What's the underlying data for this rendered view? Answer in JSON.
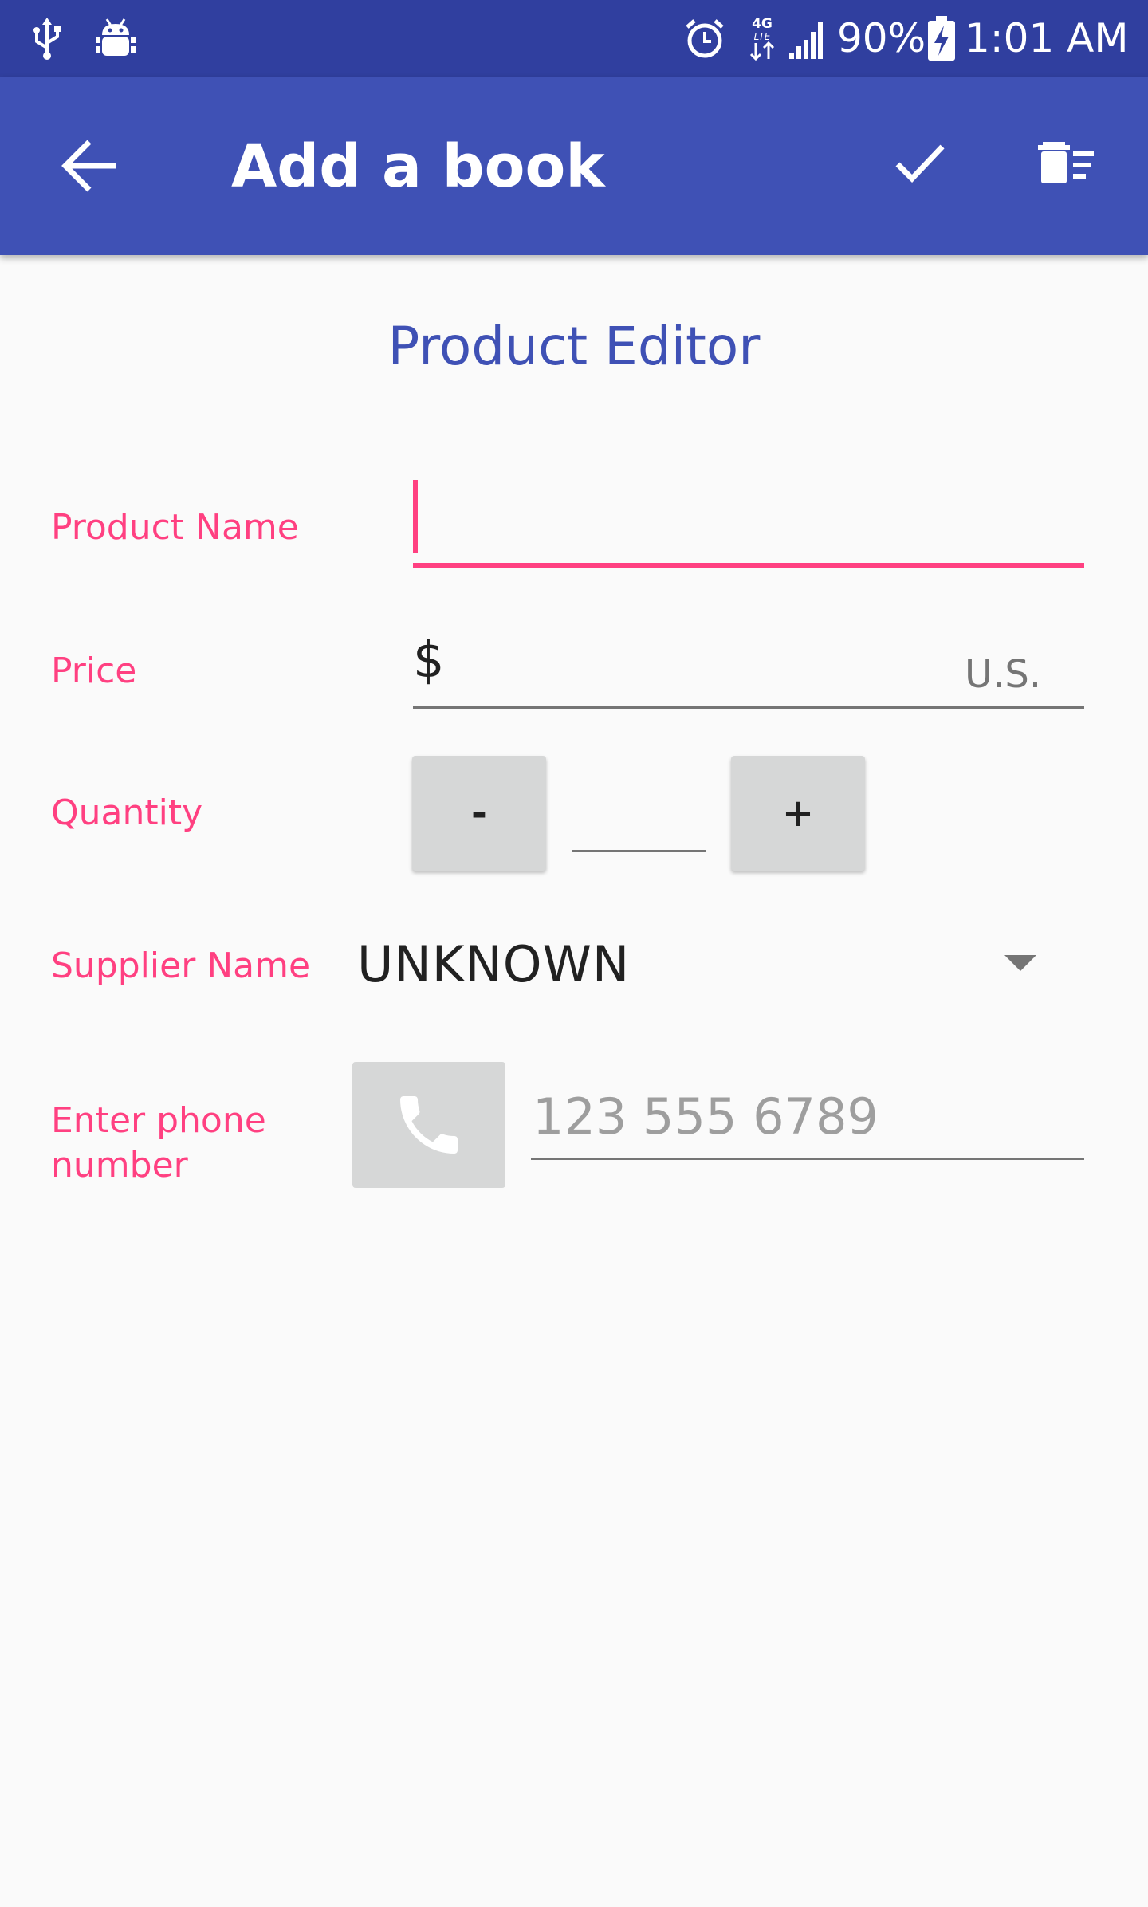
{
  "status_bar": {
    "battery": "90%",
    "time": "1:01 AM",
    "network": "4G LTE",
    "icons": [
      "usb-icon",
      "android-debug-icon",
      "alarm-icon",
      "network-4g-lte-icon",
      "signal-icon",
      "battery-charging-icon"
    ]
  },
  "app_bar": {
    "title": "Add a book",
    "icons": [
      "back-arrow-icon",
      "check-icon",
      "delete-sweep-icon"
    ]
  },
  "editor": {
    "heading": "Product Editor",
    "product_name": {
      "label": "Product Name",
      "value": ""
    },
    "price": {
      "label": "Price",
      "prefix": "$",
      "value": "",
      "suffix": "U.S."
    },
    "quantity": {
      "label": "Quantity",
      "decrement_label": "-",
      "value": "",
      "increment_label": "+"
    },
    "supplier": {
      "label": "Supplier Name",
      "selected": "UNKNOWN"
    },
    "phone": {
      "label": "Enter phone number",
      "placeholder": "123 555 6789",
      "value": "",
      "icon": "phone-icon"
    }
  },
  "colors": {
    "status_bar": "#303f9f",
    "app_bar": "#3f51b5",
    "heading": "#3f51b5",
    "accent": "#ff4081",
    "background": "#fafafa",
    "button_gray": "#d6d7d7"
  }
}
